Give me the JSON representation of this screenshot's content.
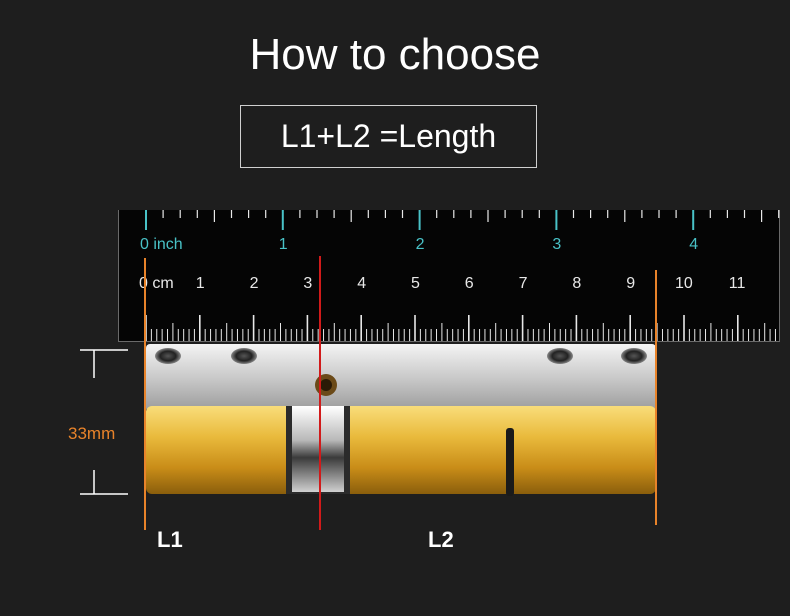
{
  "header": {
    "title": "How to choose",
    "formula": "L1+L2 =Length"
  },
  "ruler": {
    "inch_labels": [
      "0 inch",
      "1",
      "2",
      "3",
      "4"
    ],
    "cm_labels": [
      "0 cm",
      "1",
      "2",
      "3",
      "4",
      "5",
      "6",
      "7",
      "8",
      "9",
      "10",
      "11"
    ]
  },
  "dimension": {
    "height_label": "33mm"
  },
  "segments": {
    "l1": "L1",
    "l2": "L2"
  },
  "colors": {
    "accent_orange": "#e8832a",
    "cut_line_red": "#d11a1a",
    "inch_cyan": "#49c2c7",
    "brass": "#e6b53a"
  }
}
